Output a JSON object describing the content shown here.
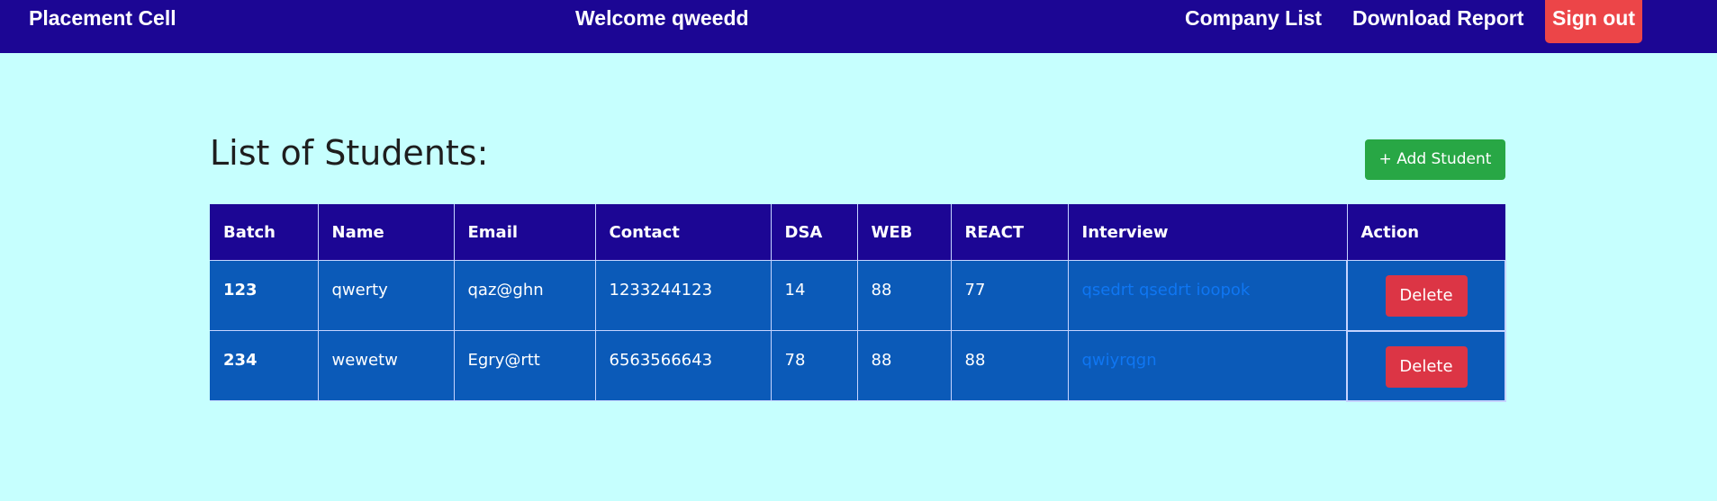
{
  "navbar": {
    "brand": "Placement Cell",
    "welcome": "Welcome qweedd",
    "company_list": "Company List",
    "download_report": "Download Report",
    "sign_out": "Sign out"
  },
  "main": {
    "title": "List of Students:",
    "add_student": "+ Add Student",
    "table": {
      "headers": [
        "Batch",
        "Name",
        "Email",
        "Contact",
        "DSA",
        "WEB",
        "REACT",
        "Interview",
        "Action"
      ],
      "rows": [
        {
          "batch": "123",
          "name": "qwerty",
          "email": "qaz@ghn",
          "contact": "1233244123",
          "dsa": "14",
          "web": "88",
          "react": "77",
          "interview": "qsedrt qsedrt ioopok",
          "action": "Delete"
        },
        {
          "batch": "234",
          "name": "wewetw",
          "email": "Egry@rtt",
          "contact": "6563566643",
          "dsa": "78",
          "web": "88",
          "react": "88",
          "interview": "qwiyrqgn",
          "action": "Delete"
        }
      ]
    }
  },
  "colors": {
    "navbar_bg": "#1c0694",
    "page_bg": "#c6fffe",
    "row_bg": "#0b5ab8",
    "sign_out_bg": "#ec4548",
    "add_button_bg": "#28a745",
    "delete_button_bg": "#dc3545",
    "link_color": "#0f76f2"
  }
}
